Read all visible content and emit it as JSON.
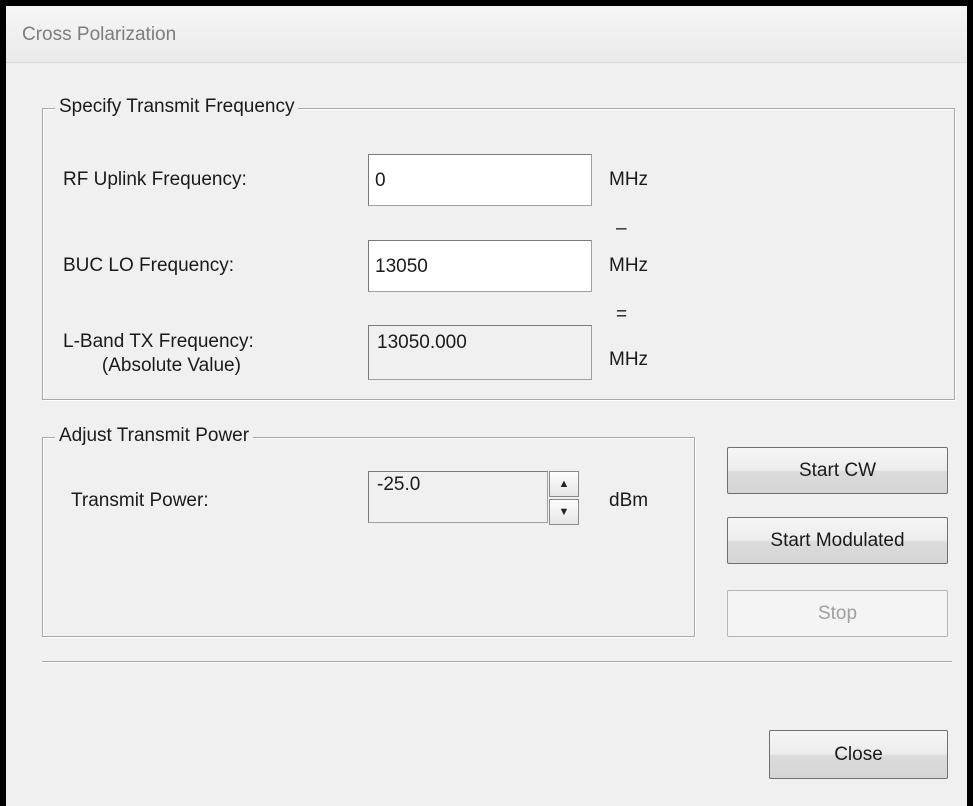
{
  "window": {
    "title": "Cross Polarization"
  },
  "frequency_group": {
    "legend": "Specify Transmit Frequency",
    "rf_uplink": {
      "label": "RF Uplink Frequency:",
      "value": "0",
      "unit": "MHz"
    },
    "minus_sign": "–",
    "buc_lo": {
      "label": "BUC LO Frequency:",
      "value": "13050",
      "unit": "MHz"
    },
    "equals_sign": "=",
    "lband_tx": {
      "label_line1": "L-Band TX Frequency:",
      "label_line2": "(Absolute Value)",
      "value": "13050.000",
      "unit": "MHz"
    }
  },
  "power_group": {
    "legend": "Adjust Transmit Power",
    "transmit_power": {
      "label": "Transmit Power:",
      "value": "-25.0",
      "unit": "dBm"
    },
    "spin_up_glyph": "▲",
    "spin_down_glyph": "▼"
  },
  "buttons": {
    "start_cw": "Start CW",
    "start_modulated": "Start Modulated",
    "stop": "Stop",
    "close": "Close"
  }
}
